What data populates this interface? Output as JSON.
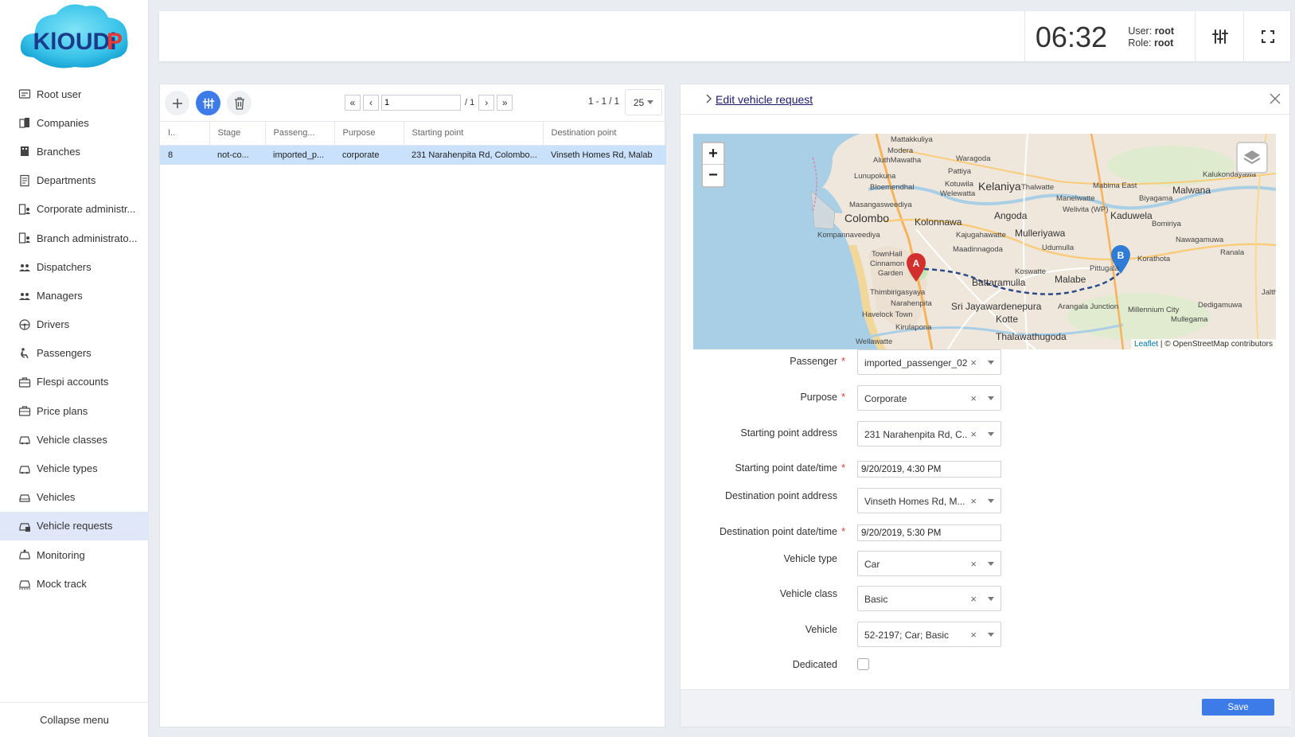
{
  "brand": {
    "logo_text": "KlOUDiP"
  },
  "sidebar": {
    "items": [
      {
        "label": "Root user",
        "icon": "id-card-icon"
      },
      {
        "label": "Companies",
        "icon": "buildings-icon"
      },
      {
        "label": "Branches",
        "icon": "building-icon"
      },
      {
        "label": "Departments",
        "icon": "document-icon"
      },
      {
        "label": "Corporate administr...",
        "icon": "building-user-icon"
      },
      {
        "label": "Branch administrato...",
        "icon": "building-user-icon"
      },
      {
        "label": "Dispatchers",
        "icon": "user-group-icon"
      },
      {
        "label": "Managers",
        "icon": "user-group-icon"
      },
      {
        "label": "Drivers",
        "icon": "steering-wheel-icon"
      },
      {
        "label": "Passengers",
        "icon": "passenger-icon"
      },
      {
        "label": "Flespi accounts",
        "icon": "briefcase-icon"
      },
      {
        "label": "Price plans",
        "icon": "briefcase-icon"
      },
      {
        "label": "Vehicle classes",
        "icon": "car-class-icon"
      },
      {
        "label": "Vehicle types",
        "icon": "car-type-icon"
      },
      {
        "label": "Vehicles",
        "icon": "car-icon"
      },
      {
        "label": "Vehicle requests",
        "icon": "car-request-icon",
        "active": true
      },
      {
        "label": "Monitoring",
        "icon": "car-monitor-icon"
      },
      {
        "label": "Mock track",
        "icon": "car-track-icon"
      }
    ],
    "collapse_label": "Collapse menu"
  },
  "header": {
    "clock": "06:32",
    "user_label": "User:",
    "user_value": "root",
    "role_label": "Role:",
    "role_value": "root"
  },
  "list": {
    "pager": {
      "first": "«",
      "prev": "‹",
      "page": "1",
      "total": "/ 1",
      "next": "›",
      "last": "»"
    },
    "range": "1 - 1 / 1",
    "per_page": "25",
    "columns": [
      "I..",
      "Stage",
      "Passeng...",
      "Purpose",
      "Starting point",
      "Destination point"
    ],
    "rows": [
      [
        "8",
        "not-co...",
        "imported_p...",
        "corporate",
        "231 Narahenpita Rd, Colombo...",
        "Vinseth Homes Rd, Malab"
      ]
    ]
  },
  "detail": {
    "title": "Edit vehicle request",
    "map": {
      "attribution_leaflet": "Leaflet",
      "attribution_rest": "| © OpenStreetMap contributors",
      "marker_a": "A",
      "marker_b": "B",
      "places": {
        "colombo": "Colombo",
        "kolonnawa": "Kolonnawa",
        "kelaniya": "Kelaniya",
        "angoda": "Angoda",
        "kaduwela": "Kaduwela",
        "mulleriyawa": "Mulleriyawa",
        "battaramulla": "Battaramulla",
        "malabe": "Malabe",
        "sri_jay": "Sri Jayawardenepura",
        "kotte": "Kotte",
        "thalawathugoda": "Thalawathugoda",
        "malwana": "Malwana",
        "mattakkuliya": "Mattakkuliya",
        "modera": "Modera",
        "bloemendhal": "Bloemendhal",
        "kompannaveediya": "Kompannaveediya",
        "townhall": "TownHall",
        "cinnamon": "Cinnamon",
        "garden": "Garden",
        "thimbirigasyaya": "Thimbirigasyaya",
        "narahenpita": "Narahenpita",
        "havelock": "Havelock Town",
        "kirulapona": "Kirulapona",
        "koswatte": "Koswatte",
        "arangala": "Arangala Junction",
        "millennium": "Millennium City",
        "mullegama": "Mullegama",
        "korathota": "Korathota",
        "bomiriya": "Bomiriya",
        "ranala": "Ranala",
        "dedigamuwa": "Dedigamuwa",
        "biyagama": "Biyagama",
        "mabima": "Mabima East",
        "welivita": "Welivita (WP)",
        "manelwatte": "Manelwatte",
        "thalwatte": "Thalwatte",
        "udumulla": "Udumulla",
        "pittugala": "Pittugala",
        "waragoda": "Waragoda",
        "lunupokuna": "Lunupokuna",
        "masangasweediya": "Masangasweediya",
        "maadinnagoda": "Maadinnagoda",
        "kajugahawatte": "Kajugahawatte",
        "nawagamuwa": "Nawagamuwa",
        "jalthara": "Jaltha",
        "kalukondayawa": "Kalukondayawa",
        "peliyagoda": "Pattiya",
        "kotuwila": "Kotuwila",
        "welewatta": "Welewatta",
        "aluthmawatha": "AluthMawatha",
        "wellawatte": "Wellawatte"
      }
    },
    "form": {
      "passenger_label": "Passenger",
      "passenger_value": "imported_passenger_02",
      "purpose_label": "Purpose",
      "purpose_value": "Corporate",
      "start_addr_label": "Starting point address",
      "start_addr_value": "231 Narahenpita Rd, C...",
      "start_dt_label": "Starting point date/time",
      "start_dt_value": "9/20/2019, 4:30 PM",
      "dest_addr_label": "Destination point address",
      "dest_addr_value": "Vinseth Homes Rd, M...",
      "dest_dt_label": "Destination point date/time",
      "dest_dt_value": "9/20/2019, 5:30 PM",
      "vtype_label": "Vehicle type",
      "vtype_value": "Car",
      "vclass_label": "Vehicle class",
      "vclass_value": "Basic",
      "vehicle_label": "Vehicle",
      "vehicle_value": "52-2197; Car; Basic",
      "dedicated_label": "Dedicated",
      "required_mark": "*",
      "clear_mark": "×"
    },
    "save_label": "Save"
  },
  "colors": {
    "accent": "#3d7be8",
    "selected_row": "#c9e1fb",
    "active_nav": "#dfe7f8",
    "marker_a": "#d32f2f",
    "marker_b": "#2f7bd6"
  }
}
